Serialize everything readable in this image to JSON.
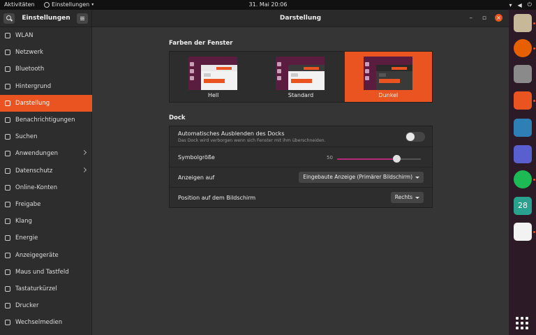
{
  "topbar": {
    "activities": "Aktivitäten",
    "app_name": "Einstellungen",
    "clock": "31. Mai  20:06"
  },
  "sidebar": {
    "title": "Einstellungen",
    "items": [
      {
        "label": "WLAN",
        "icon": "wifi-icon"
      },
      {
        "label": "Netzwerk",
        "icon": "network-icon"
      },
      {
        "label": "Bluetooth",
        "icon": "bluetooth-icon"
      },
      {
        "label": "Hintergrund",
        "icon": "background-icon"
      },
      {
        "label": "Darstellung",
        "icon": "appearance-icon",
        "active": true
      },
      {
        "label": "Benachrichtigungen",
        "icon": "bell-icon"
      },
      {
        "label": "Suchen",
        "icon": "search-icon"
      },
      {
        "label": "Anwendungen",
        "icon": "apps-icon",
        "arrow": true
      },
      {
        "label": "Datenschutz",
        "icon": "privacy-icon",
        "arrow": true
      },
      {
        "label": "Online-Konten",
        "icon": "cloud-icon"
      },
      {
        "label": "Freigabe",
        "icon": "share-icon"
      },
      {
        "label": "Klang",
        "icon": "sound-icon"
      },
      {
        "label": "Energie",
        "icon": "power-icon"
      },
      {
        "label": "Anzeigegeräte",
        "icon": "display-icon"
      },
      {
        "label": "Maus und Tastfeld",
        "icon": "mouse-icon"
      },
      {
        "label": "Tastaturkürzel",
        "icon": "keyboard-icon"
      },
      {
        "label": "Drucker",
        "icon": "printer-icon"
      },
      {
        "label": "Wechselmedien",
        "icon": "media-icon"
      }
    ]
  },
  "main": {
    "title": "Darstellung",
    "window_colors_heading": "Farben der Fenster",
    "themes": [
      {
        "label": "Hell"
      },
      {
        "label": "Standard"
      },
      {
        "label": "Dunkel",
        "selected": true
      }
    ],
    "dock_heading": "Dock",
    "autohide_label": "Automatisches Ausblenden des Docks",
    "autohide_sub": "Das Dock wird verborgen wenn sich Fenster mit ihm überschneiden.",
    "icon_size_label": "Symbolgröße",
    "icon_size_value": "50",
    "icon_size_fraction": 0.71,
    "show_on_label": "Anzeigen auf",
    "show_on_value": "Eingebaute Anzeige (Primärer Bildschirm)",
    "position_label": "Position auf dem Bildschirm",
    "position_value": "Rechts"
  },
  "dock_apps": [
    {
      "name": "files-icon",
      "color": "#c8b89a"
    },
    {
      "name": "firefox-icon",
      "color": "#e66000"
    },
    {
      "name": "settings-icon",
      "color": "#8a8a8a"
    },
    {
      "name": "software-icon",
      "color": "#e95420"
    },
    {
      "name": "image-viewer-icon",
      "color": "#2f7fb7"
    },
    {
      "name": "screenshot-icon",
      "color": "#5a5fd0"
    },
    {
      "name": "spotify-icon",
      "color": "#1db954"
    },
    {
      "name": "calendar-icon",
      "color": "#2aa08f"
    },
    {
      "name": "cards-icon",
      "color": "#f2f2f2"
    }
  ],
  "dock_calendar_day": "28",
  "colors": {
    "accent": "#e95420"
  }
}
